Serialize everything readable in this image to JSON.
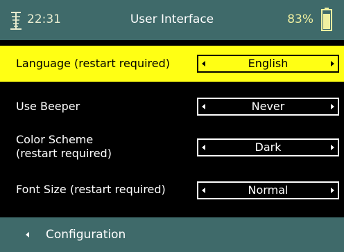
{
  "status_bar": {
    "icon": "antenna-icon",
    "time": "22:31",
    "title": "User Interface",
    "battery_percent": "83%",
    "battery_icon": "battery-icon",
    "battery_level": 0.83
  },
  "settings": [
    {
      "label": "Language (restart required)",
      "value": "English",
      "selected": true
    },
    {
      "label": "Use Beeper",
      "value": "Never",
      "selected": false
    },
    {
      "label_line1": "Color Scheme",
      "label_line2": "(restart required)",
      "value": "Dark",
      "selected": false
    },
    {
      "label": "Font Size (restart required)",
      "value": "Normal",
      "selected": false
    }
  ],
  "bottom_bar": {
    "back_icon": "chevron-left-icon",
    "back_label": "Configuration"
  },
  "colors": {
    "bar_background": "#3f6a6a",
    "highlight": "#ffff14",
    "background": "#000000",
    "text": "#ffffff",
    "battery_fill": "#f0f0a0"
  }
}
